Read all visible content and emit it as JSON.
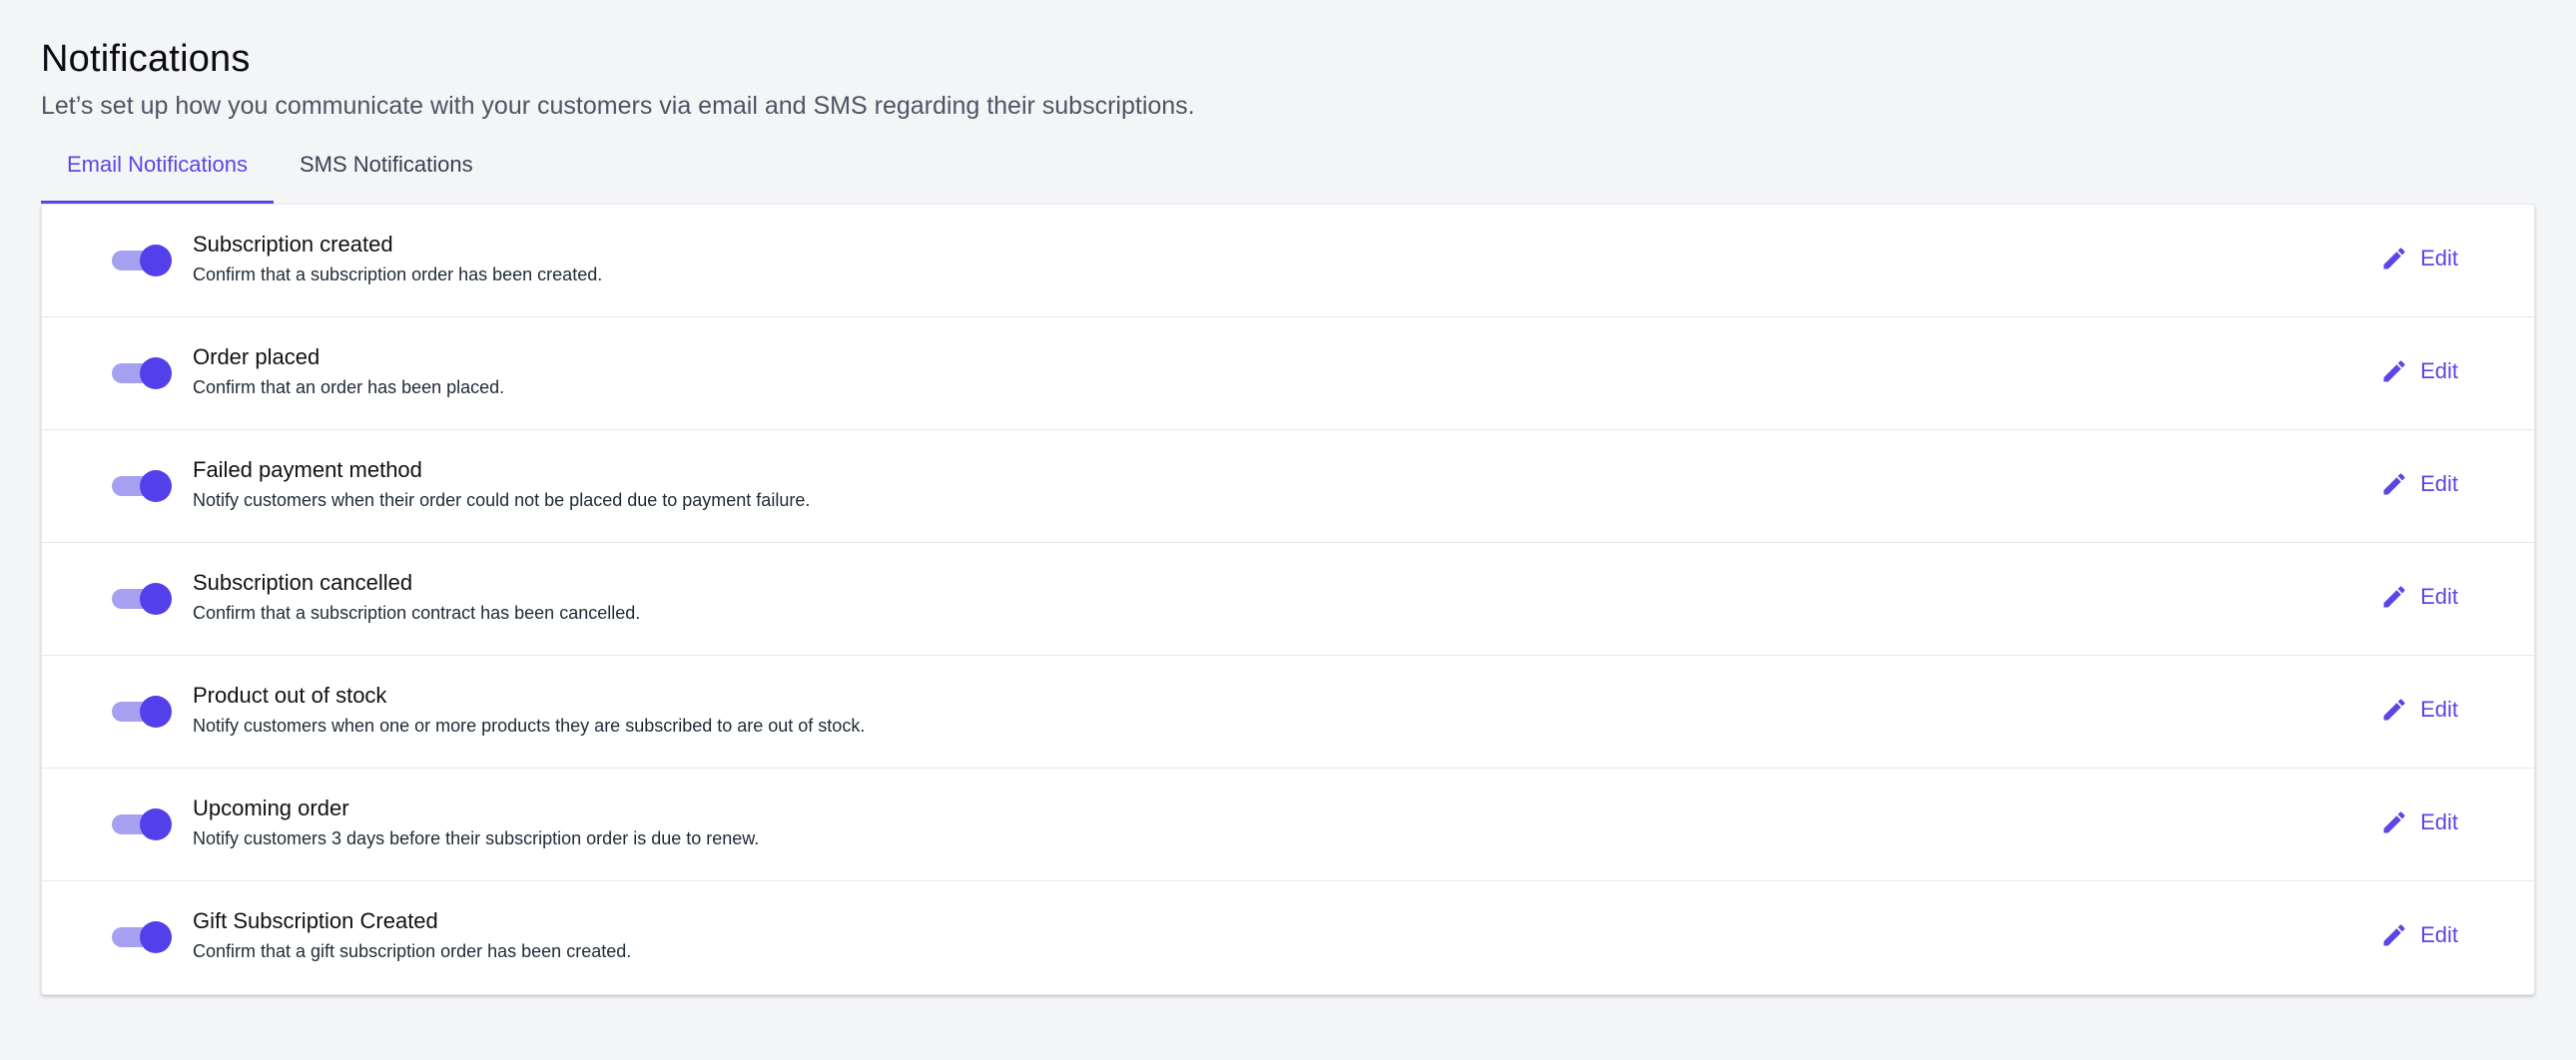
{
  "header": {
    "title": "Notifications",
    "subtitle": "Let’s set up how you communicate with your customers via email and SMS regarding their subscriptions."
  },
  "tabs": [
    {
      "label": "Email Notifications",
      "active": true
    },
    {
      "label": "SMS Notifications",
      "active": false
    }
  ],
  "colors": {
    "accent": "#5b46e5",
    "toggle_track": "#a5a0f0",
    "toggle_knob": "#5340ea"
  },
  "notifications": [
    {
      "title": "Subscription created",
      "description": "Confirm that a subscription order has been created.",
      "enabled": true,
      "edit_label": "Edit",
      "edit_icon": "pencil-icon"
    },
    {
      "title": "Order placed",
      "description": "Confirm that an order has been placed.",
      "enabled": true,
      "edit_label": "Edit",
      "edit_icon": "pencil-icon"
    },
    {
      "title": "Failed payment method",
      "description": "Notify customers when their order could not be placed due to payment failure.",
      "enabled": true,
      "edit_label": "Edit",
      "edit_icon": "pencil-icon"
    },
    {
      "title": "Subscription cancelled",
      "description": "Confirm that a subscription contract has been cancelled.",
      "enabled": true,
      "edit_label": "Edit",
      "edit_icon": "pencil-icon"
    },
    {
      "title": "Product out of stock",
      "description": "Notify customers when one or more products they are subscribed to are out of stock.",
      "enabled": true,
      "edit_label": "Edit",
      "edit_icon": "pencil-icon"
    },
    {
      "title": "Upcoming order",
      "description": "Notify customers 3 days before their subscription order is due to renew.",
      "enabled": true,
      "edit_label": "Edit",
      "edit_icon": "pencil-icon"
    },
    {
      "title": "Gift Subscription Created",
      "description": "Confirm that a gift subscription order has been created.",
      "enabled": true,
      "edit_label": "Edit",
      "edit_icon": "pencil-icon"
    }
  ]
}
